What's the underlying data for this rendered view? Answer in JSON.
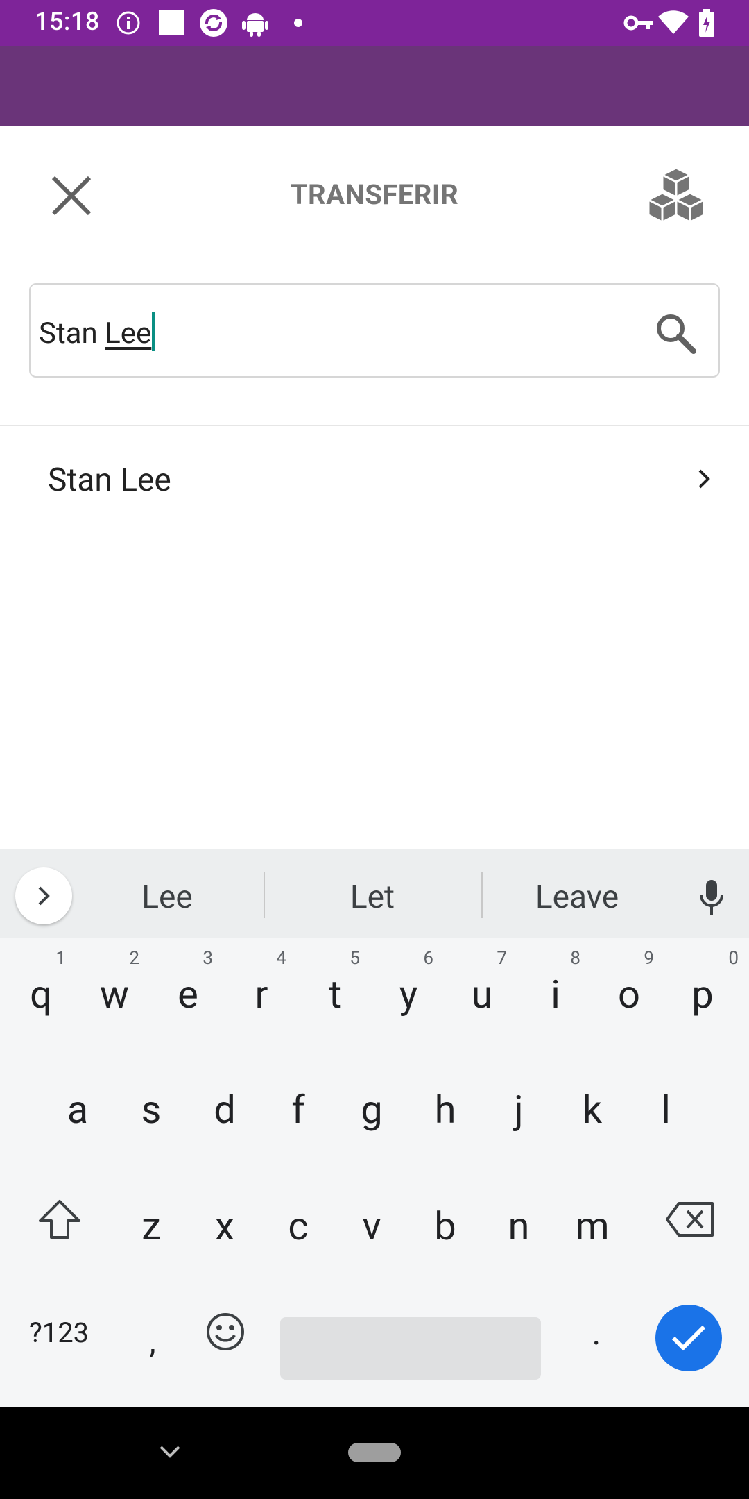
{
  "status_bar": {
    "time": "15:18",
    "left_icons": [
      "info-icon",
      "square-icon",
      "sync-icon",
      "android-icon",
      "dot-icon"
    ],
    "right_icons": [
      "vpn-key-icon",
      "wifi-icon",
      "battery-charging-icon"
    ]
  },
  "toolbar": {
    "title": "TRANSFERIR",
    "close_icon": "close-icon",
    "right_icon": "blocks-icon"
  },
  "search": {
    "prefix": "Stan ",
    "composing": "Lee",
    "icon": "search-icon"
  },
  "results": [
    {
      "label": "Stan Lee"
    }
  ],
  "keyboard": {
    "suggestions": [
      "Lee",
      "Let",
      "Leave"
    ],
    "row1": [
      {
        "ch": "q",
        "num": "1"
      },
      {
        "ch": "w",
        "num": "2"
      },
      {
        "ch": "e",
        "num": "3"
      },
      {
        "ch": "r",
        "num": "4"
      },
      {
        "ch": "t",
        "num": "5"
      },
      {
        "ch": "y",
        "num": "6"
      },
      {
        "ch": "u",
        "num": "7"
      },
      {
        "ch": "i",
        "num": "8"
      },
      {
        "ch": "o",
        "num": "9"
      },
      {
        "ch": "p",
        "num": "0"
      }
    ],
    "row2": [
      "a",
      "s",
      "d",
      "f",
      "g",
      "h",
      "j",
      "k",
      "l"
    ],
    "row3": [
      "z",
      "x",
      "c",
      "v",
      "b",
      "n",
      "m"
    ],
    "symbols_label": "?123",
    "comma": ",",
    "period": ".",
    "accent": "#1a73e8"
  },
  "colors": {
    "status_bar": "#7e2499",
    "app_band": "#6a3479",
    "caret": "#0a8f83"
  }
}
